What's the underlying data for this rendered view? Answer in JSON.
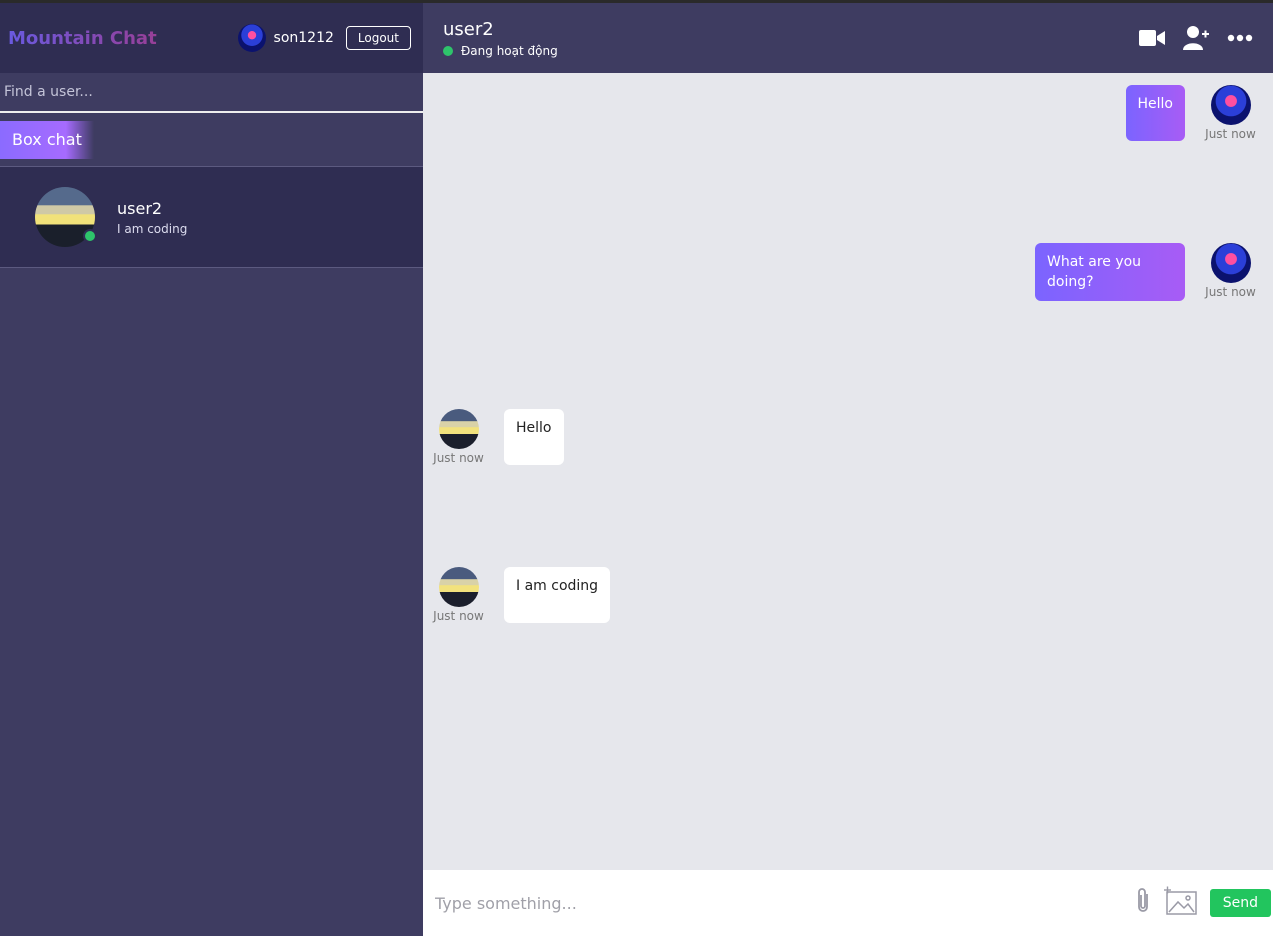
{
  "app": {
    "title": "Mountain Chat",
    "logout_label": "Logout"
  },
  "current_user": {
    "name": "son1212",
    "avatar_icon": "user-avatar-icon"
  },
  "search": {
    "placeholder": "Find a user..."
  },
  "sidebar": {
    "tab_label": "Box chat"
  },
  "conversations": [
    {
      "name": "user2",
      "last_message": "I am coding",
      "online": true
    }
  ],
  "chat_header": {
    "name": "user2",
    "status": "Đang hoạt động",
    "icons": [
      "video-camera-icon",
      "add-user-icon",
      "more-options-icon"
    ]
  },
  "messages": [
    {
      "text": "Hello",
      "time": "Just now",
      "owner": true
    },
    {
      "text": "What are you doing?",
      "time": "Just now",
      "owner": true
    },
    {
      "text": "Hello",
      "time": "Just now",
      "owner": false
    },
    {
      "text": "I am coding",
      "time": "Just now",
      "owner": false
    }
  ],
  "composer": {
    "placeholder": "Type something...",
    "send_label": "Send",
    "icons": [
      "paperclip-icon",
      "add-image-icon"
    ]
  },
  "colors": {
    "accent": "#8b6bff",
    "online": "#2ec46b",
    "sidebar_bg": "#3e3c61",
    "send": "#22c55e"
  }
}
